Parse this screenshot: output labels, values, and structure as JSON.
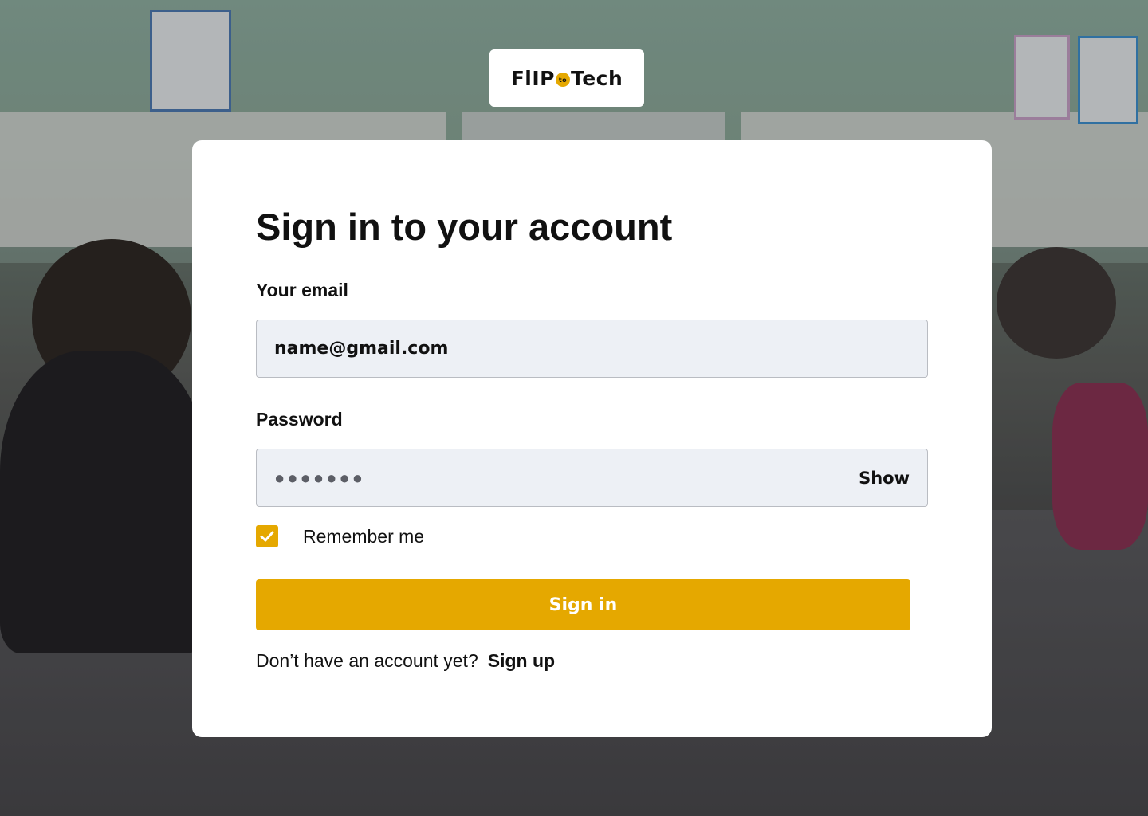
{
  "brand": {
    "logo_left": "FlIP",
    "logo_badge": "to",
    "logo_right": "Tech"
  },
  "form": {
    "title": "Sign in to your account",
    "email_label": "Your email",
    "email_value": "name@gmail.com",
    "password_label": "Password",
    "password_masked": "●●●●●●●",
    "show_label": "Show",
    "remember_label": "Remember me",
    "remember_checked": true,
    "signin_label": "Sign in",
    "signup_prompt": "Don’t have an account yet?",
    "signup_label": "Sign up"
  },
  "colors": {
    "accent": "#e5a800",
    "input_bg": "#edf0f5",
    "text": "#111111"
  }
}
